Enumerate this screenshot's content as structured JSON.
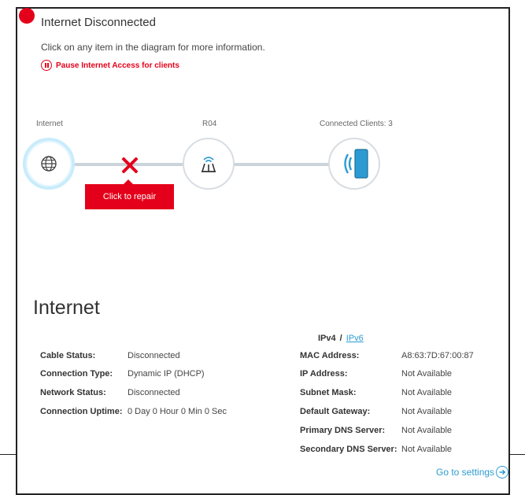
{
  "status": {
    "title": "Internet Disconnected",
    "indicator_color": "#e4001a",
    "instruction": "Click on any item in the diagram for more information.",
    "pause_label": "Pause Internet Access for clients"
  },
  "diagram": {
    "internet_label": "Internet",
    "router_label": "R04",
    "clients_label": "Connected Clients: 3",
    "repair_label": "Click to repair"
  },
  "section": {
    "title": "Internet",
    "ipv4_label": "IPv4",
    "separator": "/",
    "ipv6_label": "IPv6"
  },
  "left_details": [
    {
      "label": "Cable Status:",
      "value": "Disconnected"
    },
    {
      "label": "Connection Type:",
      "value": "Dynamic IP (DHCP)"
    },
    {
      "label": "Network Status:",
      "value": "Disconnected"
    },
    {
      "label": "Connection Uptime:",
      "value": "0 Day 0 Hour 0 Min 0 Sec"
    }
  ],
  "right_details": [
    {
      "label": "MAC Address:",
      "value": "A8:63:7D:67:00:87"
    },
    {
      "label": "IP Address:",
      "value": "Not Available"
    },
    {
      "label": "Subnet Mask:",
      "value": "Not Available"
    },
    {
      "label": "Default Gateway:",
      "value": "Not Available"
    },
    {
      "label": "Primary DNS Server:",
      "value": "Not Available"
    },
    {
      "label": "Secondary DNS Server:",
      "value": "Not Available"
    }
  ],
  "footer": {
    "settings_link": "Go to settings"
  },
  "colors": {
    "accent_red": "#e4001a",
    "link_blue": "#2d9bd2"
  }
}
